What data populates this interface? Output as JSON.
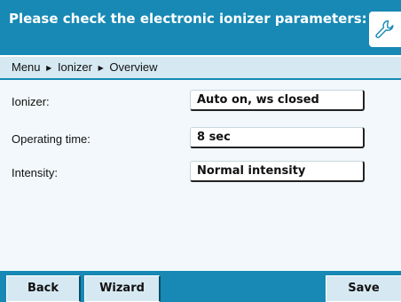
{
  "header": {
    "title": "Please check the electronic ionizer parameters:",
    "icon": "wrench-icon"
  },
  "breadcrumb": {
    "items": [
      "Menu",
      "Ionizer",
      "Overview"
    ],
    "separator": "▶"
  },
  "parameters": [
    {
      "label": "Ionizer:",
      "value": "Auto on, ws closed"
    },
    {
      "label": "Operating time:",
      "value": "8 sec"
    },
    {
      "label": "Intensity:",
      "value": "Normal intensity"
    }
  ],
  "buttons": {
    "back": "Back",
    "wizard": "Wizard",
    "save": "Save"
  },
  "colors": {
    "accent": "#1789b4",
    "breadcrumb_bg": "#d6e9f2",
    "content_bg": "#f2f8fb"
  }
}
